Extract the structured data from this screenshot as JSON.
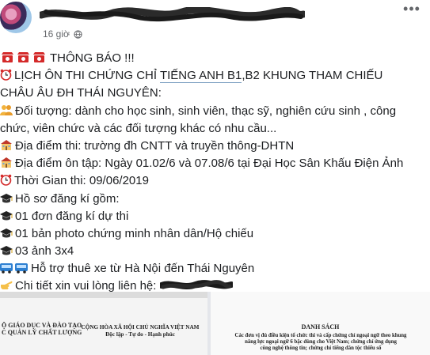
{
  "post": {
    "timestamp": "16 giờ",
    "separator": "·",
    "more_label": "•••",
    "lines": [
      {
        "icon": "telephone-icon",
        "text": "THÔNG BÁO !!!"
      },
      {
        "icon": "alarm-clock-icon",
        "pre": "LỊCH ÔN THI CHỨNG CHỈ ",
        "hl": "TIẾNG ANH B1",
        "post": ",B2 KHUNG THAM CHIẾU"
      },
      {
        "text": "CHÂU ÂU ĐH THÁI NGUYÊN:"
      },
      {
        "icon": "people-icon",
        "text": "Đối tượng: dành cho học sinh, sinh viên, thạc sỹ, nghiên cứu sinh , công"
      },
      {
        "text": "chức, viên chức và các đối tượng khác có nhu cầu..."
      },
      {
        "icon": "school-icon",
        "text": "Địa điểm thi: trường đh CNTT và truyền thông-DHTN"
      },
      {
        "icon": "school-icon",
        "text": "Địa điểm ôn tập: Ngày 01.02/6 và 07.08/6 tại Đại Học Sân Khấu Điện Ảnh"
      },
      {
        "icon": "alarm-clock-icon",
        "text": "Thời Gian thi: 09/06/2019"
      },
      {
        "icon": "graduation-cap-icon",
        "text": "Hồ sơ đăng kí gồm:"
      },
      {
        "icon": "graduation-cap-icon",
        "text": "01 đơn đăng kí dự thi"
      },
      {
        "icon": "graduation-cap-icon",
        "text": "01 bản photo chứng minh nhân dân/Hộ chiếu"
      },
      {
        "icon": "graduation-cap-icon",
        "text": "03 ảnh 3x4"
      },
      {
        "icon": "bus-icon",
        "text": "Hỗ trợ thuê xe từ Hà Nội đến Thái Nguyên"
      },
      {
        "icon": "pointing-hand-icon",
        "text": "Chi tiết xin vui lòng liên hệ: "
      }
    ]
  },
  "images": {
    "left": {
      "left_lines": [
        "Ộ GIÁO DỤC VÀ ĐÀO TẠO",
        "C QUẢN LÝ CHẤT LƯỢNG"
      ],
      "right_lines": [
        "CỘNG HÒA XÃ HỘI CHỦ NGHĨA VIỆT NAM",
        "Độc lập - Tự do - Hạnh phúc"
      ]
    },
    "right": {
      "title": "DANH SÁCH",
      "body_lines": [
        "Các đơn vị đủ điều kiện tổ chức thi và cấp chứng chỉ ngoại ngữ theo khung",
        "năng lực ngoại ngữ 6 bậc dùng cho Việt Nam; chứng chỉ ứng dụng",
        "công nghệ thông tin; chứng chỉ tiếng dân tộc thiểu số"
      ]
    }
  },
  "colors": {
    "text": "#1c1e21",
    "meta": "#65676b",
    "highlight": "#7a9ec0"
  }
}
